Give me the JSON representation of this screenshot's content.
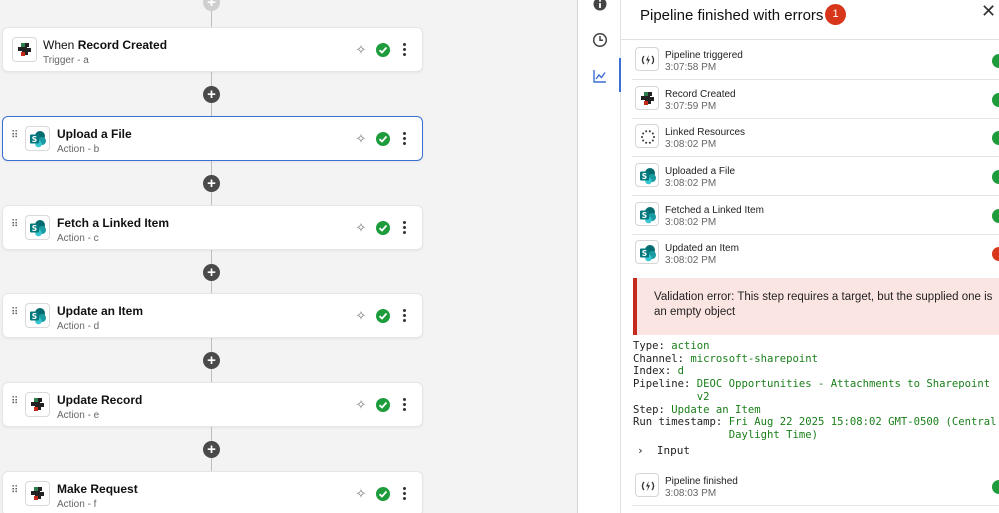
{
  "canvas": {
    "steps": [
      {
        "prefix": "When ",
        "bold": "Record Created",
        "sub": "Trigger - a",
        "icon": "record-icon",
        "draggable": false,
        "selected": false
      },
      {
        "prefix": "",
        "bold": "Upload a File",
        "sub": "Action - b",
        "icon": "sharepoint-icon",
        "draggable": true,
        "selected": true
      },
      {
        "prefix": "",
        "bold": "Fetch a Linked Item",
        "sub": "Action - c",
        "icon": "sharepoint-icon",
        "draggable": true,
        "selected": false
      },
      {
        "prefix": "",
        "bold": "Update an Item",
        "sub": "Action - d",
        "icon": "sharepoint-icon",
        "draggable": true,
        "selected": false
      },
      {
        "prefix": "",
        "bold": "Update Record",
        "sub": "Action - e",
        "icon": "record-icon",
        "draggable": true,
        "selected": false
      },
      {
        "prefix": "",
        "bold": "Make Request",
        "sub": "Action - f",
        "icon": "record-icon",
        "draggable": true,
        "selected": false
      }
    ],
    "add_label": "+"
  },
  "rail": {
    "icons": [
      "info-icon",
      "history-icon",
      "activity-chart-icon"
    ]
  },
  "panel": {
    "title": "Pipeline finished with errors",
    "error_count": "1",
    "close_label": "✕",
    "events": [
      {
        "name": "Pipeline triggered",
        "time": "3:07:58 PM",
        "icon": "trigger-icon",
        "status": "success"
      },
      {
        "name": "Record Created",
        "time": "3:07:59 PM",
        "icon": "record-icon",
        "status": "success"
      },
      {
        "name": "Linked Resources",
        "time": "3:08:02 PM",
        "icon": "spinner-icon",
        "status": "success"
      },
      {
        "name": "Uploaded a File",
        "time": "3:08:02 PM",
        "icon": "sharepoint-icon",
        "status": "success"
      },
      {
        "name": "Fetched a Linked Item",
        "time": "3:08:02 PM",
        "icon": "sharepoint-icon",
        "status": "success"
      },
      {
        "name": "Updated an Item",
        "time": "3:08:02 PM",
        "icon": "sharepoint-icon",
        "status": "error"
      }
    ],
    "error_message": "Validation error: This step requires a target, but the supplied one is an empty object",
    "details": [
      {
        "key": "Type:",
        "value": "action"
      },
      {
        "key": "Channel:",
        "value": "microsoft-sharepoint"
      },
      {
        "key": "Index:",
        "value": "d"
      },
      {
        "key": "Pipeline:",
        "value": "DEOC Opportunities - Attachments to Sharepoint v2"
      },
      {
        "key": "Step:",
        "value": "Update an Item"
      },
      {
        "key": "Run timestamp:",
        "value": "Fri Aug 22 2025 15:08:02 GMT-0500 (Central Daylight Time)"
      }
    ],
    "input_label": "Input",
    "final_event": {
      "name": "Pipeline finished",
      "time": "3:08:03 PM",
      "icon": "trigger-icon",
      "status": "success"
    }
  },
  "colors": {
    "success": "#1e9c3c",
    "error": "#d8361b",
    "accent": "#3b6fd4"
  }
}
